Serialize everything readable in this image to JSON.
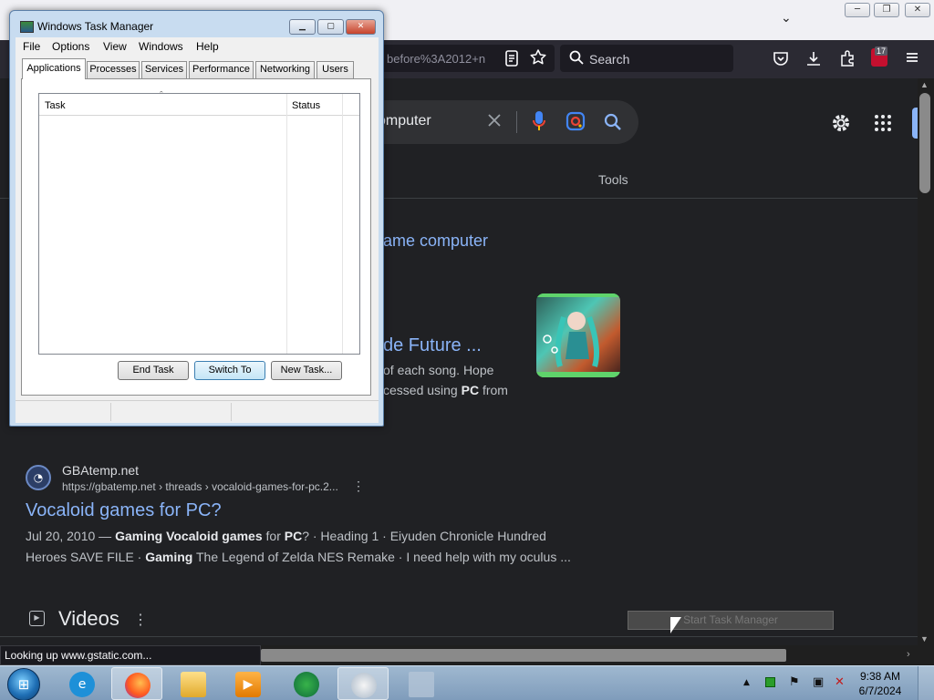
{
  "browser": {
    "url_fragment": "before%3A2012+n",
    "search_placeholder": "Search",
    "extension_badge": "17",
    "window_controls": {
      "minimize": "─",
      "restore": "❐",
      "close": "✕"
    },
    "dropdown_glyph": "⌄",
    "icons": [
      "reader-mode-icon",
      "bookmark-star-icon",
      "pocket-icon",
      "download-icon",
      "extensions-icon",
      "ublock-icon",
      "menu-icon"
    ]
  },
  "google": {
    "query_visible": "omputer",
    "tools_label": "Tools",
    "result1_link": "ame computer",
    "result2": {
      "title": "de Future ...",
      "snippet_line1": "of each song. Hope",
      "snippet_line2_pre": "cessed using ",
      "snippet_line2_bold": "PC",
      "snippet_line2_post": " from"
    },
    "gbatemp": {
      "site": "GBAtemp.net",
      "breadcrumb": "https://gbatemp.net › threads › vocaloid-games-for-pc.2...",
      "title": "Vocaloid games for PC?",
      "line1": {
        "date": "Jul 20, 2010 — ",
        "b1": "Gaming Vocaloid games",
        "t1": " for ",
        "b2": "PC",
        "t2": "? · Heading 1 · Eiyuden Chronicle Hundred"
      },
      "line2": {
        "t1": "Heroes SAVE FILE · ",
        "b1": "Gaming",
        "t2": " The Legend of Zelda NES Remake · I need help with my oculus ..."
      }
    },
    "videos_heading": "Videos",
    "more_glyph": "⋮"
  },
  "tooltip": "Start Task Manager",
  "status_text": "Looking up www.gstatic.com...",
  "task_manager": {
    "title": "Windows Task Manager",
    "menu": [
      "File",
      "Options",
      "View",
      "Windows",
      "Help"
    ],
    "tabs": [
      "Applications",
      "Processes",
      "Services",
      "Performance",
      "Networking",
      "Users"
    ],
    "active_tab": "Applications",
    "columns": {
      "task": "Task",
      "status": "Status"
    },
    "sort_glyph": "ˆ",
    "buttons": {
      "end_task": "End Task",
      "switch_to": "Switch To",
      "new_task": "New Task..."
    },
    "controls": {
      "minimize": "▁",
      "maximize": "▢",
      "close": "✕"
    }
  },
  "taskbar": {
    "apps": [
      "internet-explorer",
      "firefox",
      "file-explorer",
      "media-player",
      "app-green",
      "paint",
      "unknown-app"
    ],
    "active_apps": [
      "firefox",
      "paint"
    ],
    "time": "9:38 AM",
    "date": "6/7/2024",
    "tray_glyphs": {
      "up": "▲",
      "flag": "⚑",
      "net": "▣",
      "vol": "✕"
    }
  },
  "colors": {
    "link": "#8ab4f8",
    "page_bg": "#202124",
    "toolbar": "#2b2a33",
    "taskbar": "#8fabc6"
  }
}
